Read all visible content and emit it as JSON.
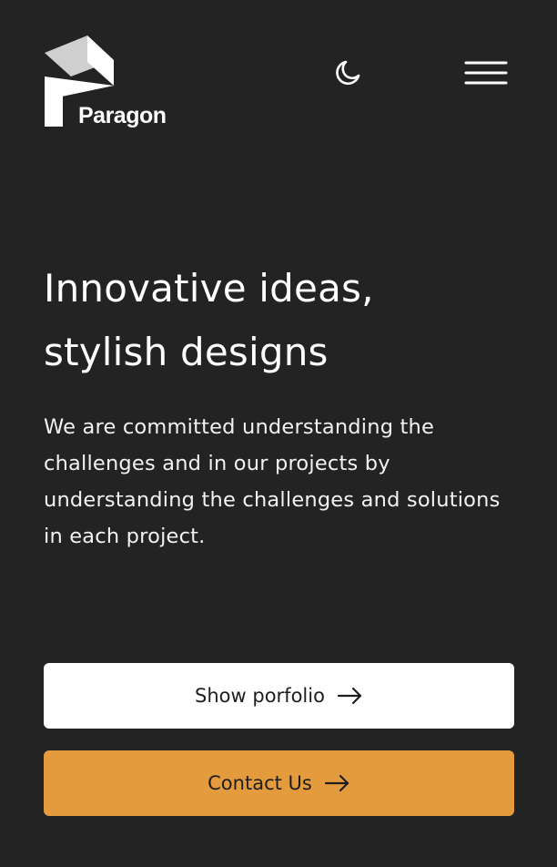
{
  "header": {
    "brand_name": "Paragon",
    "theme_toggle_icon": "moon-icon",
    "menu_icon": "hamburger-menu-icon"
  },
  "hero": {
    "title_line1": "Innovative ideas,",
    "title_line2": "stylish designs",
    "description": "We are committed understanding the challenges and in our projects by understanding the challenges and solutions in each project."
  },
  "actions": {
    "portfolio_label": "Show porfolio",
    "contact_label": "Contact Us",
    "arrow_icon": "arrow-right-icon"
  },
  "colors": {
    "background": "#232323",
    "text": "#ffffff",
    "primary_button": "#ffffff",
    "accent_button": "#e49b3d",
    "button_text": "#1e1e1e"
  }
}
